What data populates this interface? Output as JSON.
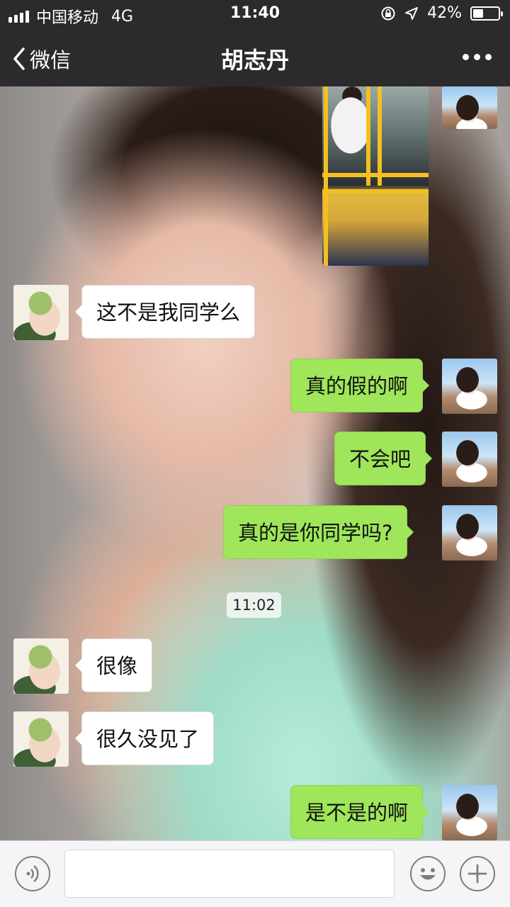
{
  "status_bar": {
    "carrier": "中国移动",
    "network": "4G",
    "time": "11:40",
    "battery_percent": "42%",
    "battery_level": 0.42
  },
  "nav": {
    "back_label": "微信",
    "title": "胡志丹",
    "more_icon": "more-dots-icon"
  },
  "chat": {
    "messages": [
      {
        "side": "in",
        "text": "这不是我同学么"
      },
      {
        "side": "out",
        "text": "真的假的啊"
      },
      {
        "side": "out",
        "text": "不会吧"
      },
      {
        "side": "out",
        "text": "真的是你同学吗?"
      },
      {
        "side": "in",
        "text": "很像"
      },
      {
        "side": "in",
        "text": "很久没见了"
      },
      {
        "side": "out",
        "text": "是不是的啊"
      }
    ],
    "timestamp": "11:02"
  },
  "input_bar": {
    "voice_icon": "voice-icon",
    "emoji_icon": "emoji-icon",
    "add_icon": "plus-icon",
    "message_value": ""
  },
  "colors": {
    "bar_bg": "#2b2b2d",
    "outgoing_bubble": "#9fe65a",
    "incoming_bubble": "#ffffff"
  }
}
